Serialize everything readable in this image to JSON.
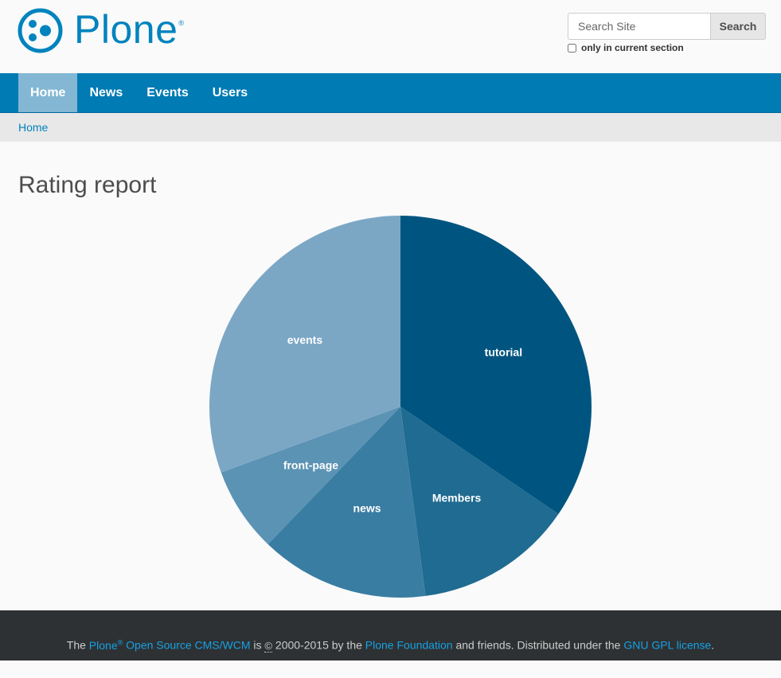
{
  "site": {
    "logo_text": "Plone",
    "logo_reg": "®",
    "brand_color": "#0083be"
  },
  "search": {
    "placeholder": "Search Site",
    "button_label": "Search",
    "section_label": "only in current section"
  },
  "nav": {
    "items": [
      {
        "label": "Home",
        "active": true
      },
      {
        "label": "News",
        "active": false
      },
      {
        "label": "Events",
        "active": false
      },
      {
        "label": "Users",
        "active": false
      }
    ],
    "bg_color": "#007bb3"
  },
  "breadcrumb": {
    "home": "Home"
  },
  "page": {
    "title": "Rating report"
  },
  "chart_data": {
    "type": "pie",
    "categories": [
      "tutorial",
      "Members",
      "news",
      "front-page",
      "events"
    ],
    "values": [
      34.5,
      13.4,
      14.3,
      7.2,
      30.6
    ],
    "colors": [
      "#005580",
      "#1f6b91",
      "#3a7da2",
      "#5b93b4",
      "#7ba7c5"
    ],
    "title": ""
  },
  "footer": {
    "the": "The",
    "plone": "Plone",
    "reg": "®",
    "oss": "Open Source CMS/WCM",
    "is": "is",
    "copy_symbol": "©",
    "years": "2000-2015 by the",
    "foundation": "Plone Foundation",
    "friends": "and friends. Distributed under the",
    "license": "GNU GPL license",
    "period": "."
  }
}
